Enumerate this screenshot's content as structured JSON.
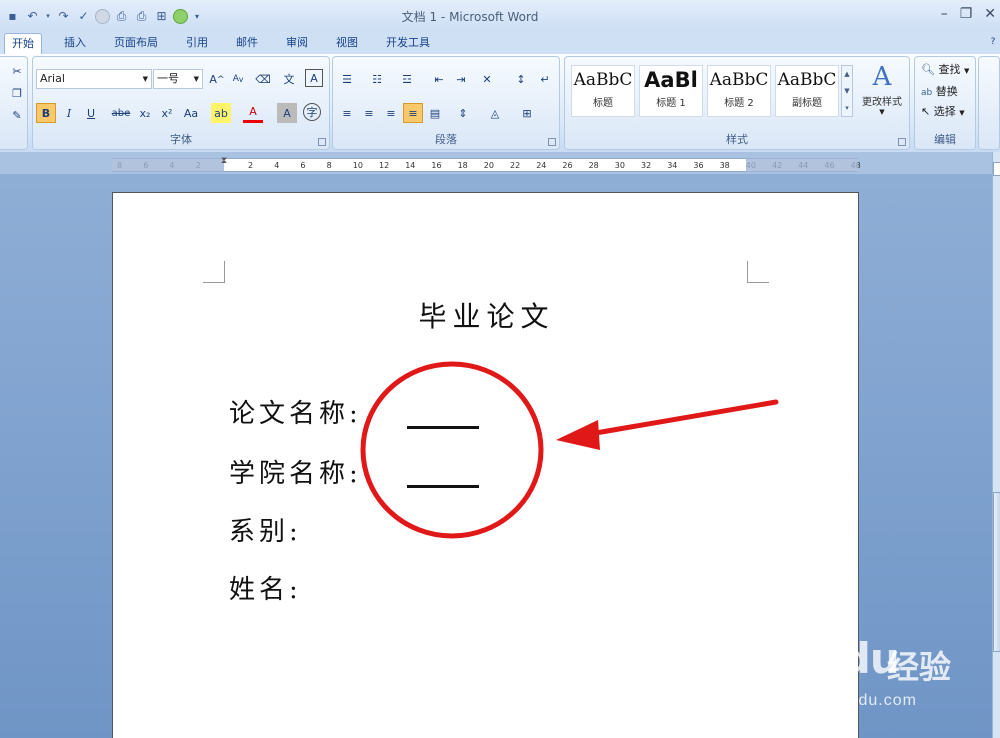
{
  "window": {
    "title": "文档 1 - Microsoft Word",
    "controls": [
      "–",
      "❐",
      "✕"
    ]
  },
  "tabs": [
    "开始",
    "插入",
    "页面布局",
    "引用",
    "邮件",
    "审阅",
    "视图",
    "开发工具"
  ],
  "font_group": {
    "font_name": "Arial",
    "font_size": "一号",
    "label": "字体",
    "row2": [
      "B",
      "I",
      "U",
      "abe",
      "x₂",
      "x²",
      "Aa"
    ]
  },
  "paragraph_group": {
    "label": "段落"
  },
  "styles_group": {
    "label": "样式",
    "styles": [
      {
        "preview": "AaBbC",
        "name": "标题"
      },
      {
        "preview": "AaBl",
        "name": "标题 1"
      },
      {
        "preview": "AaBbC",
        "name": "标题 2"
      },
      {
        "preview": "AaBbC",
        "name": "副标题"
      }
    ],
    "change_styles": "更改样式"
  },
  "editing_group": {
    "label": "编辑",
    "find": "查找",
    "replace": "替换",
    "select": "选择"
  },
  "ruler": {
    "ticks": [
      "8",
      "6",
      "4",
      "2",
      "",
      "2",
      "4",
      "6",
      "8",
      "10",
      "12",
      "14",
      "16",
      "18",
      "20",
      "22",
      "24",
      "26",
      "28",
      "30",
      "32",
      "34",
      "36",
      "38",
      "40",
      "42",
      "44",
      "46",
      "48"
    ]
  },
  "document": {
    "title": "毕业论文",
    "fields": [
      "论文名称:",
      "学院名称:",
      "系别:",
      "姓名:"
    ]
  },
  "annotation": {
    "circle_color": "#e01818",
    "arrow_color": "#e01818"
  },
  "watermark": {
    "brand": "Baidu",
    "brand_cn": "经验",
    "url": "jingyan.baidu.com"
  }
}
